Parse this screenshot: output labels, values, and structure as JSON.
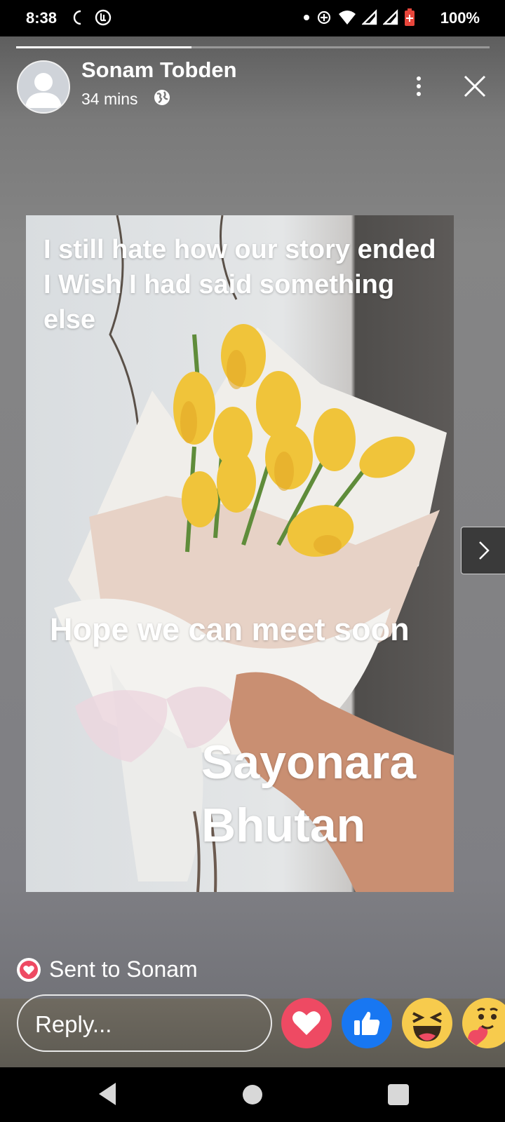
{
  "status_bar": {
    "time": "8:38",
    "battery": "100%",
    "icons": [
      "moon-icon",
      "data-saver-icon",
      "dot-icon",
      "sync-icon",
      "wifi-icon",
      "signal-icon",
      "signal-icon",
      "battery-icon"
    ]
  },
  "story": {
    "progress": 0.37,
    "author": "Sonam Tobden",
    "time": "34 mins",
    "privacy_icon": "globe-icon",
    "text_1": "I still hate how our story ended\nI Wish I had said something else",
    "text_2": "Hope we can meet soon",
    "text_3": "Sayonara\nBhutan"
  },
  "footer": {
    "sent_label": "Sent to Sonam",
    "reply_placeholder": "Reply...",
    "reactions": [
      "love",
      "like",
      "haha",
      "care"
    ]
  },
  "colors": {
    "love": "#ee4a63",
    "like": "#1877f2",
    "haha": "#f7cb4d"
  }
}
